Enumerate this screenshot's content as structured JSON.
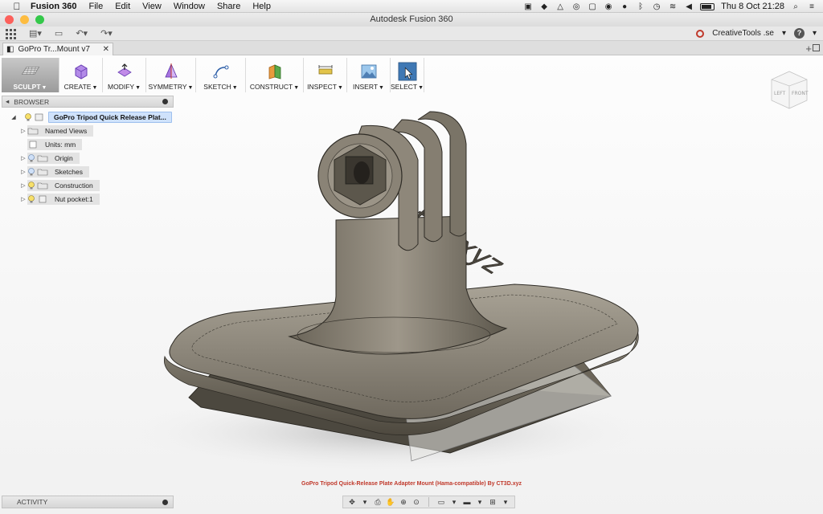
{
  "menubar": {
    "apple_icon": "apple-icon",
    "app_name": "Fusion 360",
    "items": [
      "File",
      "Edit",
      "View",
      "Window",
      "Share",
      "Help"
    ],
    "clock": "Thu 8 Oct  21:28"
  },
  "window": {
    "title": "Autodesk Fusion 360",
    "traffic_lights": [
      "#fc605b",
      "#fdbc40",
      "#34c84a"
    ]
  },
  "qat": {
    "user": "CreativeTools .se",
    "help": "?"
  },
  "tab": {
    "label": "GoPro Tr...Mount v7"
  },
  "toolbar": {
    "groups": [
      {
        "label": "SCULPT",
        "icon": "sculpt-icon"
      },
      {
        "label": "CREATE",
        "icon": "create-icon"
      },
      {
        "label": "MODIFY",
        "icon": "modify-icon"
      },
      {
        "label": "SYMMETRY",
        "icon": "symmetry-icon"
      },
      {
        "label": "SKETCH",
        "icon": "sketch-icon"
      },
      {
        "label": "CONSTRUCT",
        "icon": "construct-icon"
      },
      {
        "label": "INSPECT",
        "icon": "inspect-icon"
      },
      {
        "label": "INSERT",
        "icon": "insert-icon"
      },
      {
        "label": "SELECT",
        "icon": "select-icon"
      }
    ]
  },
  "browser": {
    "title": "BROWSER",
    "root": "GoPro Tripod Quick Release Plat...",
    "nodes": [
      {
        "label": "Named Views"
      },
      {
        "label": "Units: mm"
      },
      {
        "label": "Origin"
      },
      {
        "label": "Sketches"
      },
      {
        "label": "Construction"
      },
      {
        "label": "Nut pocket:1"
      }
    ]
  },
  "viewcube": {
    "left": "LEFT",
    "front": "FRONT"
  },
  "model": {
    "engraved_text": "ct3d.xyz"
  },
  "caption": "GoPro Tripod Quick-Release Plate Adapter Mount (Hama-compatible) By CT3D.xyz",
  "activity": {
    "title": "ACTIVITY"
  }
}
